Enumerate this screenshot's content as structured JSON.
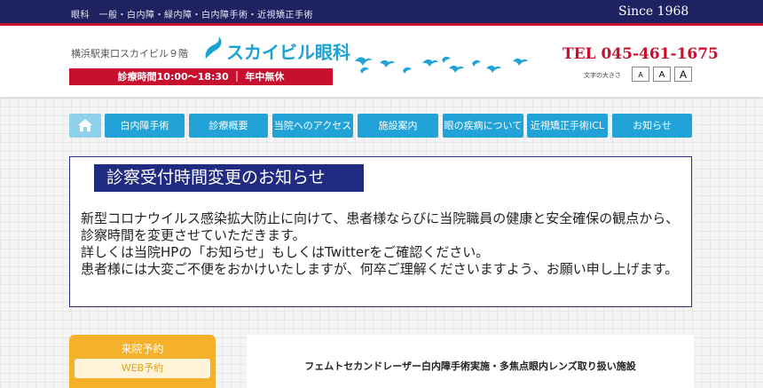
{
  "topbar": {
    "tagline": "眼科　一般・白内障・緑内障・白内障手術・近視矯正手術",
    "since": "Since 1968"
  },
  "header": {
    "address": "横浜駅東口スカイビル９階",
    "logo_text": "スカイビル眼科",
    "hours": "診療時間10:00～18:30 ｜ 年中無休",
    "tel": "TEL 045-461-1675",
    "fontsize_label": "文字の大きさ",
    "fontsize_options": [
      "A",
      "A",
      "A"
    ]
  },
  "nav": {
    "home_icon": "home-icon",
    "items": [
      "白内障手術",
      "診療概要",
      "当院へのアクセス",
      "施設案内",
      "眼の疾病について",
      "近視矯正手術ICL",
      "お知らせ"
    ]
  },
  "notice": {
    "title": "診察受付時間変更のお知らせ",
    "lines": [
      "新型コロナウイルス感染拡大防止に向けて、患者様ならびに当院職員の健康と安全確保の観点から、診察時間を変更させていただきます。",
      "詳しくは当院HPの「お知らせ」もしくはTwitterをご確認ください。",
      "患者様には大変ご不便をおかけいたしますが、何卒ご理解くださいますよう、お願い申し上げます。"
    ]
  },
  "sidebar": {
    "heading": "来院予約",
    "web_button": "WEB予約"
  },
  "main": {
    "headline": "フェムトセカンドレーザー白内障手術実施・多焦点眼内レンズ取り扱い施設"
  },
  "colors": {
    "navy": "#1f2260",
    "red": "#c8102e",
    "blue": "#21a3d8",
    "orange": "#f5b12c"
  }
}
